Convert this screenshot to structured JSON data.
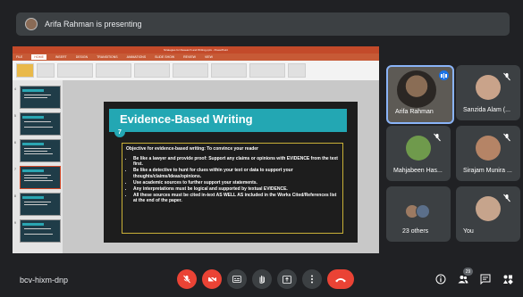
{
  "presenting": {
    "text": "Arifa Rahman is presenting"
  },
  "ppt": {
    "window_title": "Strategies for Research and Writing.pptx - PowerPoint",
    "tabs": [
      "FILE",
      "HOME",
      "INSERT",
      "DESIGN",
      "TRANSITIONS",
      "ANIMATIONS",
      "SLIDE SHOW",
      "REVIEW",
      "VIEW"
    ],
    "active_tab": "HOME",
    "thumb_numbers": [
      "4",
      "5",
      "6",
      "7",
      "8",
      "9"
    ]
  },
  "slide": {
    "title": "Evidence-Based Writing",
    "number": "7",
    "objective": "Objective for evidence-based writing: To convince your reader",
    "bullets": [
      "Be like a lawyer and provide proof: Support any claims or opinions with EVIDENCE from the text first.",
      "Be like a detective to hunt for clues within your text or data to support your thoughts/claims/ideas/opinions.",
      "Use academic sources to further support your statements.",
      "Any interpretations must be logical and supported by textual EVIDENCE.",
      "All these sources must be cited in-text AS WELL AS included in the Works Cited/References list at the end of the paper."
    ]
  },
  "participants": {
    "presenter": "Arifa Rahman",
    "sanzida": "Sanzida Alam (...",
    "mahjabeen": "Mahjabeen Has...",
    "sirajam": "Sirajam Munira ...",
    "others": "23 others",
    "you": "You"
  },
  "footer": {
    "meeting_code": "bcv-hixm-dnp",
    "people_count": "29"
  },
  "colors": {
    "accent": "#23a7b3",
    "end_call": "#ea4335",
    "ppt_brand": "#c34a2a"
  }
}
